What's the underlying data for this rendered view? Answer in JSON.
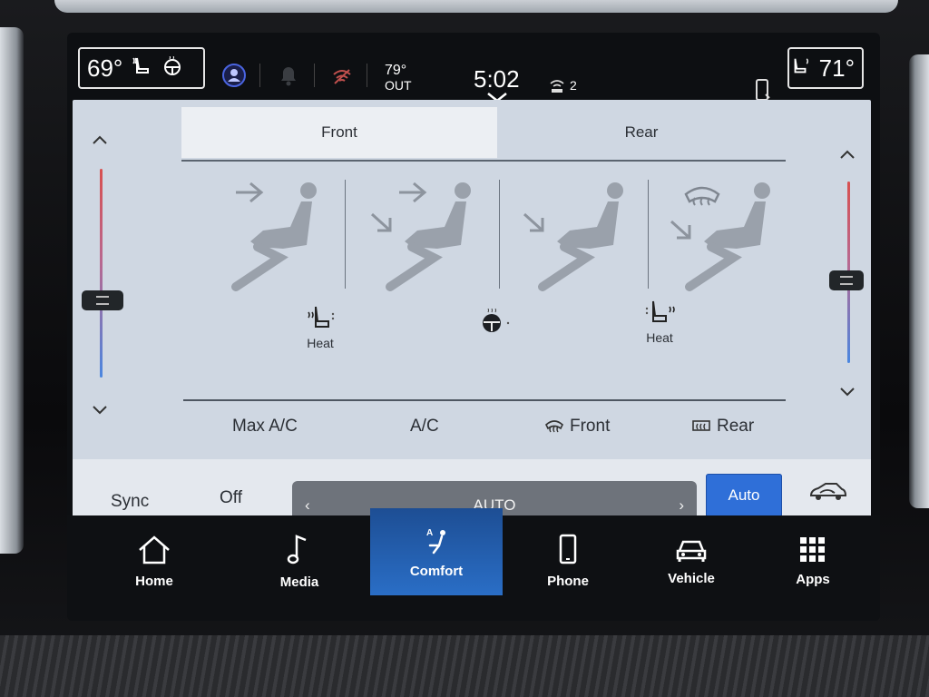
{
  "status_bar": {
    "driver_temp": "69°",
    "passenger_temp": "71°",
    "outside_temp": "79°",
    "outside_label": "OUT",
    "time": "5:02",
    "wifi_devices": "2"
  },
  "climate": {
    "tabs": [
      {
        "label": "Front",
        "active": true
      },
      {
        "label": "Rear",
        "active": false
      }
    ],
    "left_seat_label": "Heat",
    "right_seat_label": "Heat",
    "options": {
      "max_ac": "Max A/C",
      "ac": "A/C",
      "front_defrost": "Front",
      "rear_defrost": "Rear"
    },
    "sync_label": "Sync",
    "fan_state": "Off",
    "fan_mode": "AUTO",
    "fan_left_arrow": "‹",
    "fan_right_arrow": "›",
    "auto_label": "Auto"
  },
  "nav": {
    "items": [
      {
        "label": "Home",
        "icon": "home-icon"
      },
      {
        "label": "Media",
        "icon": "music-note-icon"
      },
      {
        "label": "Comfort",
        "icon": "seat-comfort-icon",
        "active": true
      },
      {
        "label": "Phone",
        "icon": "phone-icon"
      },
      {
        "label": "Vehicle",
        "icon": "car-icon"
      },
      {
        "label": "Apps",
        "icon": "apps-grid-icon"
      }
    ]
  },
  "colors": {
    "accent": "#2f6fd8",
    "panel_bg": "#cfd7e2",
    "nav_active": "#2a6ec6"
  }
}
